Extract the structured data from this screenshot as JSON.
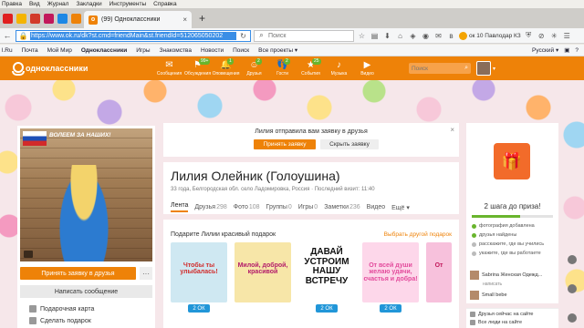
{
  "browser": {
    "menu": [
      "Правка",
      "Вид",
      "Журнал",
      "Закладки",
      "Инструменты",
      "Справка"
    ],
    "tab_title": "(99) Одноклассники",
    "url": "https://www.ok.ru/dk?st.cmd=friendMain&st.friendId=512065050202",
    "search_placeholder": "Поиск",
    "weather": "ок 10 Павлодар КЗ",
    "bookmarks": [
      "Почта",
      "Мой Мир",
      "Одноклассники",
      "Игры",
      "Знакомства",
      "Новости",
      "Поиск",
      "Все проекты ▾"
    ],
    "bookmark_first": "l.Ru",
    "language": "Русский ▾",
    "pinned_colors": [
      "#e02020",
      "#f4b400",
      "#d23a2a",
      "#c2185b",
      "#1e88e5",
      "#ee8208"
    ]
  },
  "header": {
    "logo": "одноклассники",
    "nav": [
      {
        "icon": "✉",
        "label": "Сообщения",
        "badge": ""
      },
      {
        "icon": "⚑",
        "label": "Обсуждения",
        "badge": "99+"
      },
      {
        "icon": "🔔",
        "label": "Оповещения",
        "badge": "1"
      },
      {
        "icon": "☺",
        "label": "Друзья",
        "badge": "2"
      },
      {
        "icon": "👣",
        "label": "Гости",
        "badge": "2"
      },
      {
        "icon": "★",
        "label": "События",
        "badge": "25"
      },
      {
        "icon": "♪",
        "label": "Музыка",
        "badge": ""
      },
      {
        "icon": "▶",
        "label": "Видео",
        "badge": ""
      }
    ],
    "search_placeholder": "Поиск"
  },
  "left": {
    "photo_caption": "ВОЛЕЕМ ЗА НАШИХ!",
    "add_friend": "Принять заявку в друзья",
    "more": "···",
    "message": "Написать сообщение",
    "links": [
      "Подарочная карта",
      "Сделать подарок"
    ]
  },
  "notification": {
    "text": "Лилия отправила вам заявку в друзья",
    "accept": "Принять заявку",
    "hide": "Скрыть заявку",
    "close": "×"
  },
  "profile": {
    "name": "Лилия Олейник (Голоушина)",
    "meta": "33 года, Белгородская обл. село Ладомировка, Россия  ·  Последний визит: 11:40",
    "tabs": [
      {
        "label": "Лента",
        "count": ""
      },
      {
        "label": "Друзья",
        "count": "298"
      },
      {
        "label": "Фото",
        "count": "108"
      },
      {
        "label": "Группы",
        "count": "0"
      },
      {
        "label": "Игры",
        "count": "0"
      },
      {
        "label": "Заметки",
        "count": "236"
      },
      {
        "label": "Видео",
        "count": ""
      },
      {
        "label": "Ещё ▾",
        "count": ""
      }
    ]
  },
  "gifts": {
    "title": "Подарите Лилии красивый подарок",
    "link": "Выбрать другой подарок",
    "items": [
      {
        "text": "Чтобы ты улыбалась!",
        "price": "2 ОК",
        "bg": "#cfe8f2",
        "fg": "#d12c2c"
      },
      {
        "text": "Милой, доброй, красивой",
        "price": "",
        "bg": "#f7e6a8",
        "fg": "#b31b6a"
      },
      {
        "text": "ДАВАЙ УСТРОИМ НАШУ ВСТРЕЧУ",
        "price": "2 ОК",
        "bg": "#ffffff",
        "fg": "#111111"
      },
      {
        "text": "От всей души желаю удачи, счастья и добра!",
        "price": "2 ОК",
        "bg": "#fdd7ea",
        "fg": "#e34b9c"
      },
      {
        "text": "От",
        "price": "",
        "bg": "#f7c1dc",
        "fg": "#c2185b"
      }
    ]
  },
  "right": {
    "steps_title": "2 шага до приза!",
    "progress": 0.6,
    "steps": [
      {
        "label": "фотография добавлена",
        "done": true
      },
      {
        "label": "друзья найдены",
        "done": true
      },
      {
        "label": "расскажите, где вы учились",
        "done": false
      },
      {
        "label": "укажите, где вы работаете",
        "done": false
      }
    ],
    "friends": [
      {
        "name": "Sabrina Женская Одежд...",
        "sub": "написать"
      },
      {
        "name": "Small bebe",
        "sub": ""
      }
    ],
    "chat": [
      "Друзья сейчас на сайте",
      "Все люди на сайте"
    ]
  }
}
